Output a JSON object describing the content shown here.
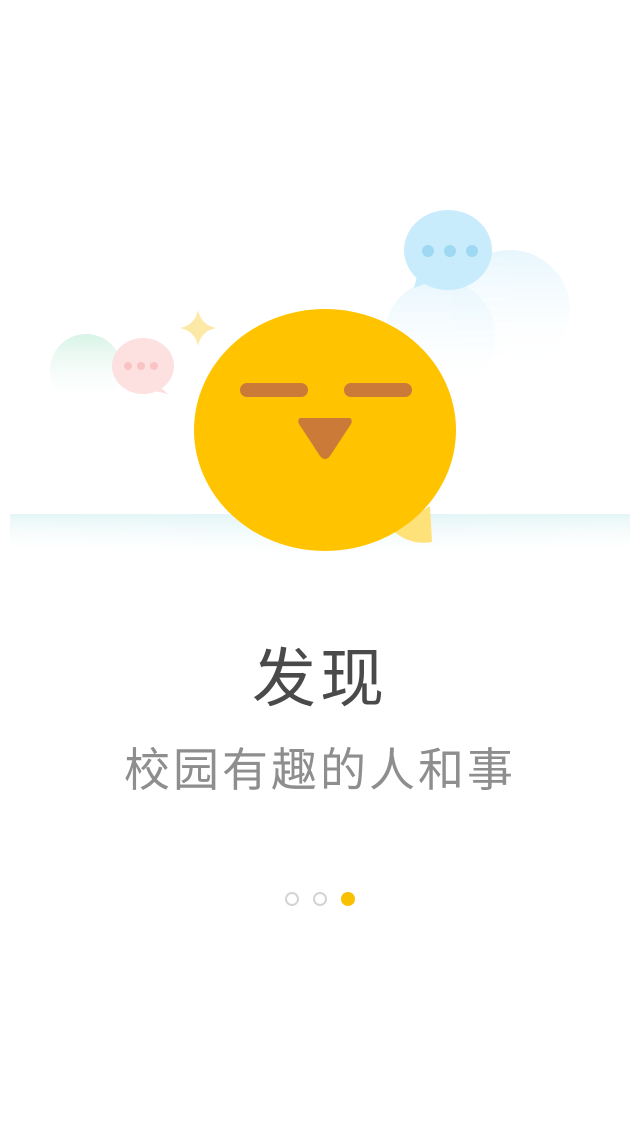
{
  "onboarding": {
    "title": "发现",
    "subtitle": "校园有趣的人和事",
    "pager": {
      "total": 3,
      "active_index": 2
    },
    "mascot": "yellow-chick-icon"
  },
  "colors": {
    "accent": "#f9c000",
    "mascot_body": "#ffc300",
    "mascot_beak": "#cc7a38",
    "bubble_blue": "#c9ecfc",
    "bubble_pink": "#fde0e0",
    "sparkle": "#fde9a6",
    "title_text": "#4a4a4a",
    "subtitle_text": "#8e8e8e",
    "dot_inactive": "#d4d4d4"
  }
}
